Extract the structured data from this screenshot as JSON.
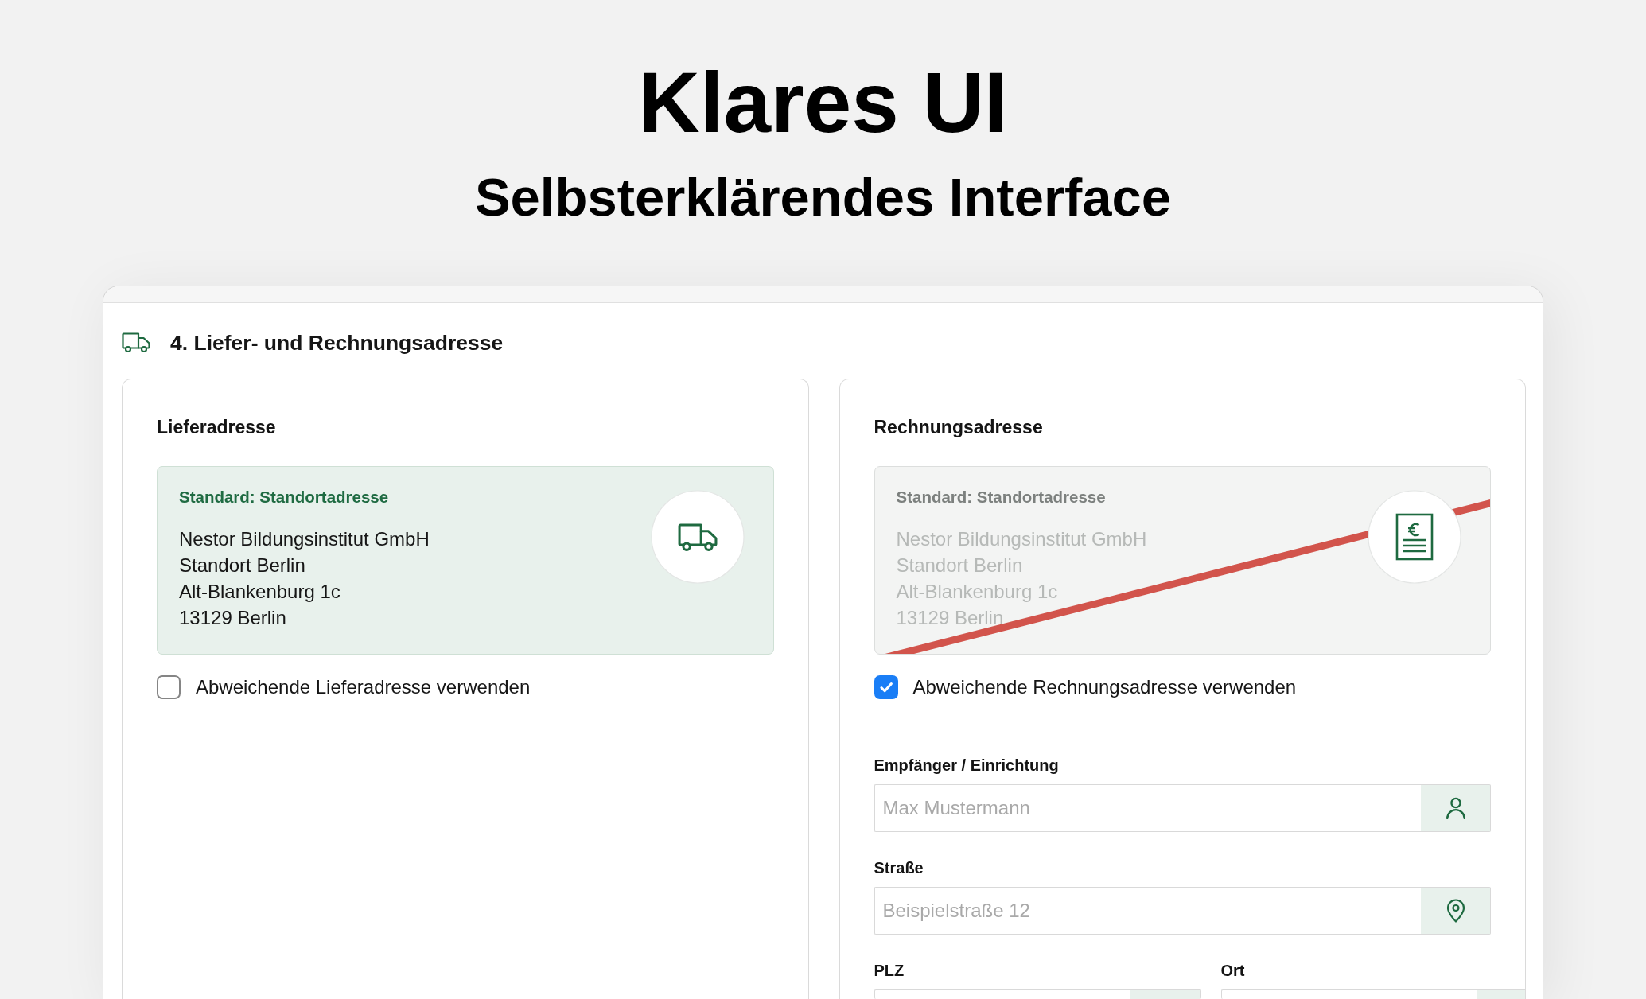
{
  "heading": {
    "title": "Klares UI",
    "subtitle": "Selbsterklärendes Interface"
  },
  "section": {
    "title": "4. Liefer- und Rechnungsadresse"
  },
  "panels": [
    {
      "kind": "delivery",
      "title": "Lieferadresse",
      "default_address": {
        "label": "Standard: Standortadresse",
        "lines": [
          "Nestor Bildungsinstitut GmbH",
          "Standort Berlin",
          "Alt-Blankenburg 1c",
          "13129 Berlin"
        ]
      },
      "option": {
        "label": "Abweichende Lieferadresse verwenden",
        "checked": false
      }
    },
    {
      "kind": "billing",
      "title": "Rechnungsadresse",
      "default_address": {
        "label": "Standard: Standortadresse",
        "lines": [
          "Nestor Bildungsinstitut GmbH",
          "Standort Berlin",
          "Alt-Blankenburg 1c",
          "13129 Berlin"
        ]
      },
      "option": {
        "label": "Abweichende Rechnungsadresse verwenden",
        "checked": true
      },
      "form": {
        "rows": [
          {
            "fields": [
              {
                "kind": "recipient",
                "label": "Empfänger / Einrichtung",
                "placeholder": "Max Mustermann"
              }
            ]
          },
          {
            "fields": [
              {
                "kind": "street",
                "label": "Straße",
                "placeholder": "Beispielstraße 12"
              }
            ]
          },
          {
            "fields": [
              {
                "kind": "postcode",
                "label": "PLZ"
              },
              {
                "kind": "city",
                "label": "Ort"
              }
            ]
          }
        ]
      }
    }
  ]
}
